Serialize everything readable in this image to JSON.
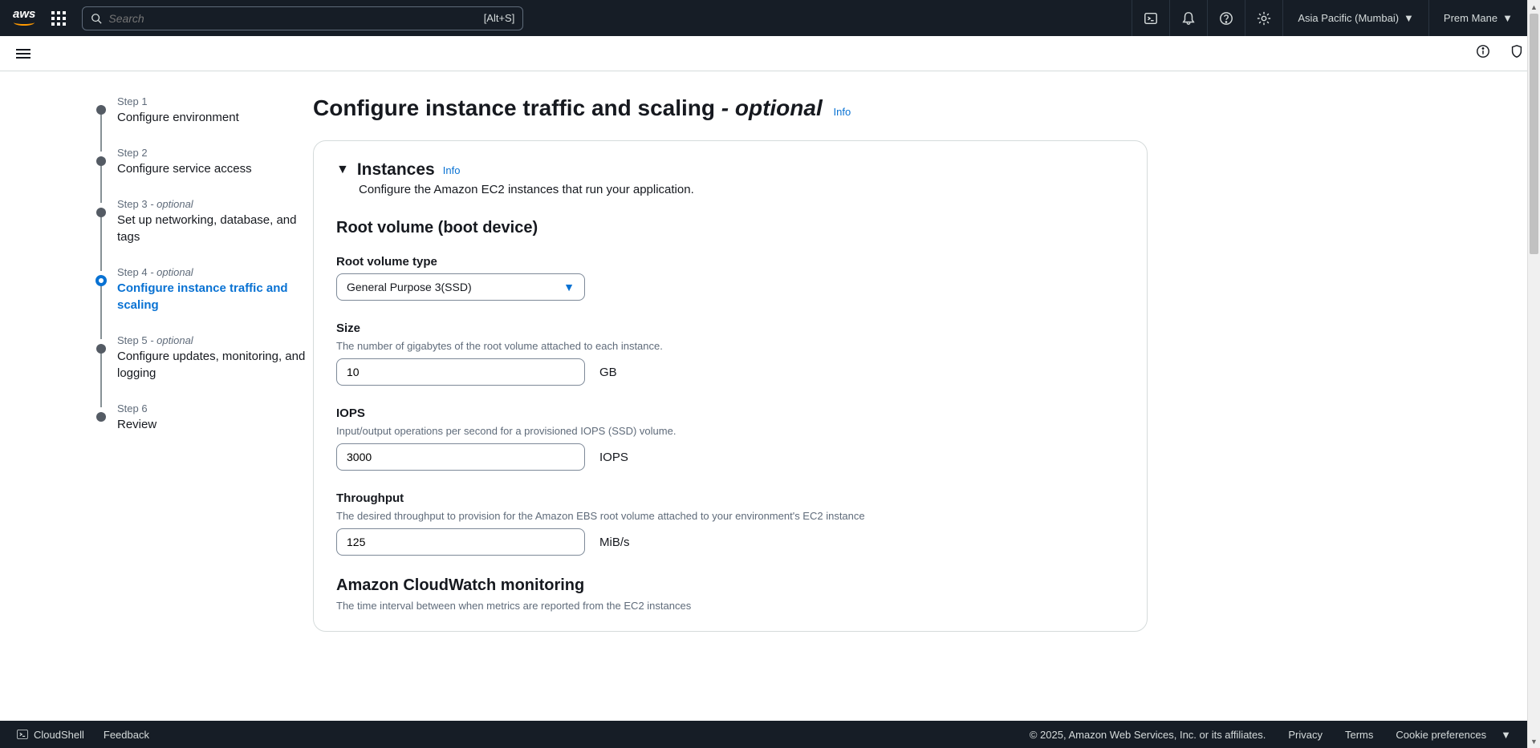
{
  "nav": {
    "logo": "aws",
    "search_placeholder": "Search",
    "search_shortcut": "[Alt+S]",
    "region": "Asia Pacific (Mumbai)",
    "user": "Prem Mane"
  },
  "steps": [
    {
      "num": "Step 1",
      "title": "Configure environment",
      "optional": false
    },
    {
      "num": "Step 2",
      "title": "Configure service access",
      "optional": false
    },
    {
      "num": "Step 3",
      "title": "Set up networking, database, and tags",
      "optional": true
    },
    {
      "num": "Step 4",
      "title": "Configure instance traffic and scaling",
      "optional": true
    },
    {
      "num": "Step 5",
      "title": "Configure updates, monitoring, and logging",
      "optional": true
    },
    {
      "num": "Step 6",
      "title": "Review",
      "optional": false
    }
  ],
  "page": {
    "title": "Configure instance traffic and scaling",
    "optional_word": "- optional",
    "info": "Info"
  },
  "instances": {
    "title": "Instances",
    "info": "Info",
    "desc": "Configure the Amazon EC2 instances that run your application.",
    "root_volume_title": "Root volume (boot device)",
    "volume_type": {
      "label": "Root volume type",
      "value": "General Purpose 3(SSD)"
    },
    "size": {
      "label": "Size",
      "helper": "The number of gigabytes of the root volume attached to each instance.",
      "value": "10",
      "unit": "GB"
    },
    "iops": {
      "label": "IOPS",
      "helper": "Input/output operations per second for a provisioned IOPS (SSD) volume.",
      "value": "3000",
      "unit": "IOPS"
    },
    "throughput": {
      "label": "Throughput",
      "helper": "The desired throughput to provision for the Amazon EBS root volume attached to your environment's EC2 instance",
      "value": "125",
      "unit": "MiB/s"
    },
    "cloudwatch": {
      "title": "Amazon CloudWatch monitoring",
      "desc": "The time interval between when metrics are reported from the EC2 instances"
    }
  },
  "footer": {
    "cloudshell": "CloudShell",
    "feedback": "Feedback",
    "copyright": "© 2025, Amazon Web Services, Inc. or its affiliates.",
    "privacy": "Privacy",
    "terms": "Terms",
    "cookies": "Cookie preferences"
  }
}
